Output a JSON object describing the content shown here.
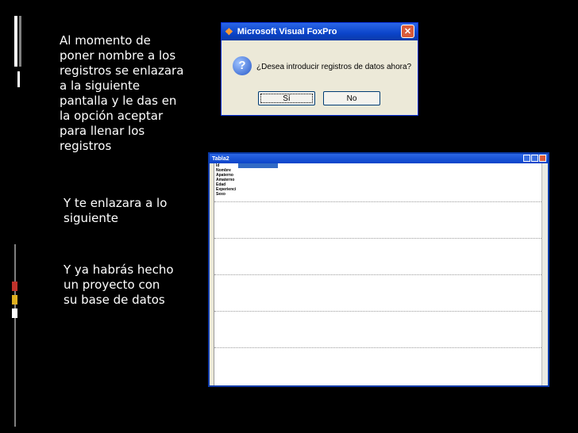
{
  "slide": {
    "paragraph1": "Al momento de poner nombre a los registros se enlazara a  la siguiente pantalla y le das en la opción aceptar para llenar los registros",
    "paragraph2": "Y te enlazara a lo siguiente",
    "paragraph3": "Y ya habrás hecho un proyecto con su base de datos"
  },
  "dialog": {
    "title": "Microsoft Visual FoxPro",
    "message": "¿Desea introducir registros de datos ahora?",
    "yes_label": "Sí",
    "no_label": "No",
    "close_glyph": "✕"
  },
  "table_window": {
    "title": "Tabla2",
    "fields": [
      "Id",
      "Nombre",
      "Apaterno",
      "Amaterno",
      "Edad",
      "Experienci",
      "Sexo"
    ]
  },
  "colors": {
    "background": "#000000",
    "accent_red": "#c0322b",
    "accent_yellow": "#e0b020",
    "titlebar_blue": "#0b44c9"
  },
  "icons": {
    "dialog_icon": "foxpro-icon",
    "question": "question-icon",
    "close": "close-icon"
  }
}
